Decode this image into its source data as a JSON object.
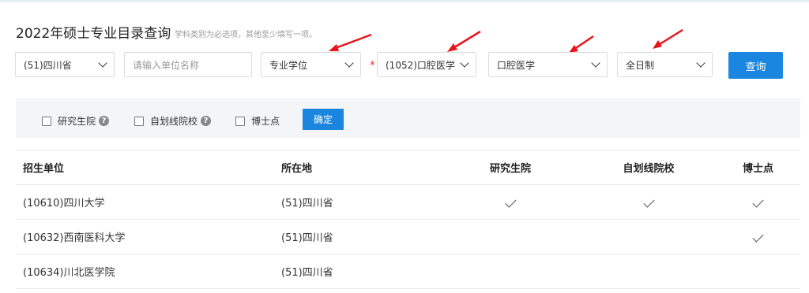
{
  "header": {
    "title": "2022年硕士专业目录查询",
    "hint": "学科类别为必选项，其他至少填写一项。"
  },
  "form": {
    "province": "(51)四川省",
    "unit_placeholder": "请输入单位名称",
    "degree_type": "专业学位",
    "required_mark": "*",
    "discipline": "(1052)口腔医学",
    "major": "口腔医学",
    "study_mode": "全日制",
    "query_label": "查询"
  },
  "filters": {
    "graduate_school": "研究生院",
    "self_line": "自划线院校",
    "doctoral": "博士点",
    "help_icon": "question-icon",
    "confirm_label": "确定"
  },
  "table": {
    "headers": [
      "招生单位",
      "所在地",
      "研究生院",
      "自划线院校",
      "博士点"
    ],
    "rows": [
      {
        "unit": "(10610)四川大学",
        "location": "(51)四川省",
        "graduate_school": true,
        "self_line": true,
        "doctoral": true
      },
      {
        "unit": "(10632)西南医科大学",
        "location": "(51)四川省",
        "graduate_school": false,
        "self_line": false,
        "doctoral": true
      },
      {
        "unit": "(10634)川北医学院",
        "location": "(51)四川省",
        "graduate_school": false,
        "self_line": false,
        "doctoral": false
      }
    ]
  },
  "colors": {
    "accent": "#1a86e0",
    "arrow": "#e8141a"
  }
}
